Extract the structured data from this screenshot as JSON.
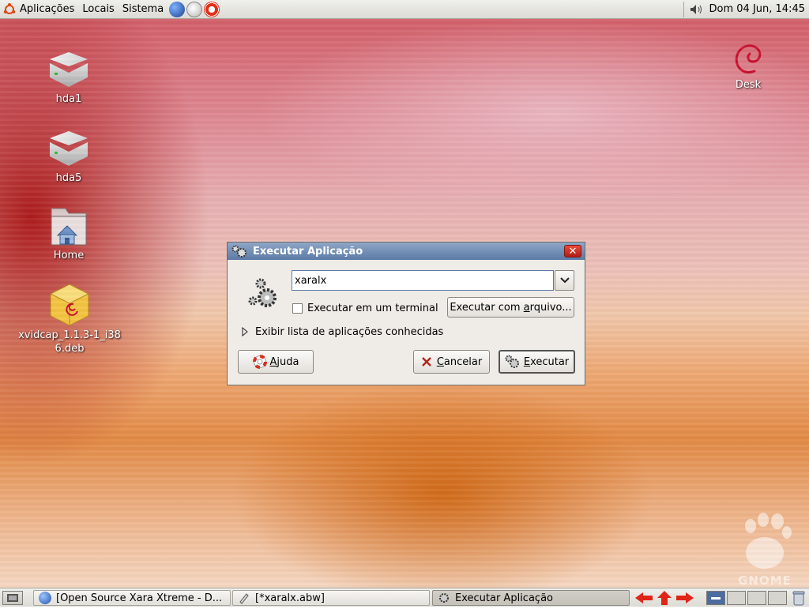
{
  "top_panel": {
    "menus": [
      "Aplicações",
      "Locais",
      "Sistema"
    ],
    "launchers": [
      "web-browser-icon",
      "email-client-icon",
      "help-icon"
    ],
    "clock": "Dom 04 Jun, 14:45"
  },
  "desktop": {
    "icons": [
      {
        "label": "hda1",
        "icon": "hard-drive-icon"
      },
      {
        "label": "hda5",
        "icon": "hard-drive-icon"
      },
      {
        "label": "Home",
        "icon": "home-folder-icon"
      },
      {
        "label": "xvidcap_1.1.3-1_i386.deb",
        "icon": "debian-package-icon"
      },
      {
        "label": "Desk",
        "icon": "debian-swirl-icon"
      }
    ],
    "watermark": "GNOME"
  },
  "dialog": {
    "title": "Executar Aplicação",
    "command_value": "xaralx",
    "terminal_checkbox_label": "Executar em um terminal",
    "terminal_checked": false,
    "run_with_file_label": "Executar com arquivo...",
    "known_apps_label": "Exibir lista de aplicações conhecidas",
    "help_label": "Ajuda",
    "cancel_label": "Cancelar",
    "run_label": "Executar"
  },
  "taskbar": {
    "tasks": [
      {
        "label": "[Open Source Xara Xtreme - D...",
        "icon": "globe-icon",
        "active": false
      },
      {
        "label": "[*xaralx.abw]",
        "icon": "pen-icon",
        "active": false
      },
      {
        "label": "Executar Aplicação",
        "icon": "gears-icon",
        "active": true
      }
    ],
    "workspaces": 4,
    "active_workspace": 1
  },
  "colors": {
    "titlebar": "#5b7aa6",
    "close_button": "#c8281c",
    "dialog_bg": "#efebe7"
  }
}
